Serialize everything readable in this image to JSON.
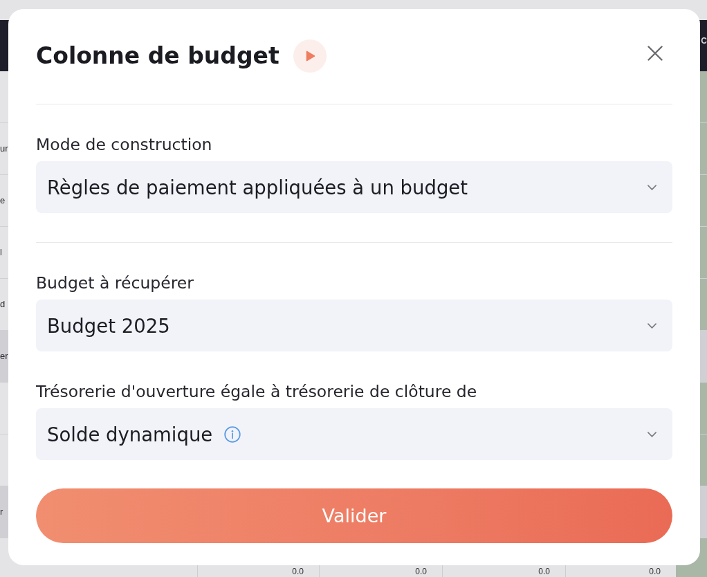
{
  "background_table": {
    "header_text": "C",
    "rows": [
      {
        "highlighted": false
      },
      {
        "label": "ur",
        "highlighted": false
      },
      {
        "label": "e",
        "highlighted": false
      },
      {
        "label": "l",
        "highlighted": false
      },
      {
        "label": "d",
        "highlighted": false
      },
      {
        "label": "er",
        "highlighted": true
      },
      {
        "highlighted": false
      },
      {
        "highlighted": false
      },
      {
        "label": "r",
        "highlighted": true
      }
    ],
    "bottom_row": [
      "0.0",
      "0.0",
      "0.0",
      "0.0"
    ]
  },
  "dialog": {
    "title": "Colonne de budget",
    "sections": [
      {
        "fields": [
          {
            "label": "Mode de construction",
            "value": "Règles de paiement appliquées à un budget",
            "info": false
          }
        ]
      },
      {
        "fields": [
          {
            "label": "Budget à récupérer",
            "value": "Budget 2025",
            "info": false
          },
          {
            "label": "Trésorerie d'ouverture égale à trésorerie de clôture de",
            "value": "Solde dynamique",
            "info": true
          }
        ]
      }
    ],
    "submit_button": "Valider"
  }
}
